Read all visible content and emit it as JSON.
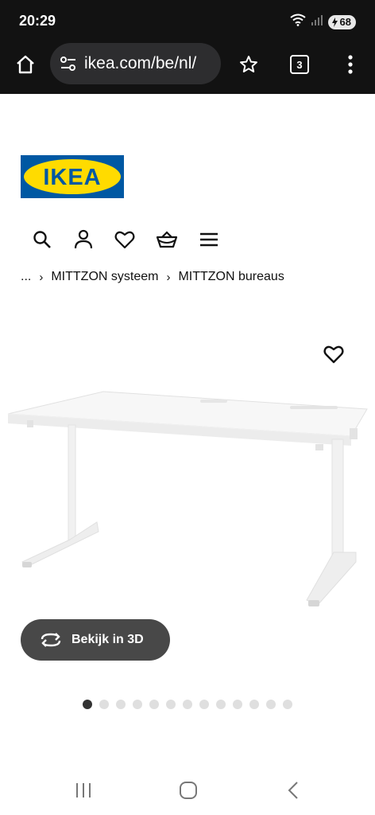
{
  "status_bar": {
    "time": "20:29",
    "battery": "68"
  },
  "browser": {
    "url": "ikea.com/be/nl/",
    "tab_count": "3"
  },
  "site": {
    "logo_text": "IKEA",
    "brand_colors": {
      "blue": "#0058a3",
      "yellow": "#ffdb00"
    }
  },
  "nav_icons": [
    "search-icon",
    "account-icon",
    "heart-icon",
    "basket-icon",
    "menu-icon"
  ],
  "breadcrumb": {
    "ellipsis": "...",
    "items": [
      "MITTZON systeem",
      "MITTZON bureaus"
    ]
  },
  "product": {
    "view_3d_label": "Bekijk in 3D",
    "gallery": {
      "total_images": 13,
      "active_index": 0
    }
  },
  "android_nav": [
    "recent-apps-icon",
    "home-icon",
    "back-icon"
  ]
}
